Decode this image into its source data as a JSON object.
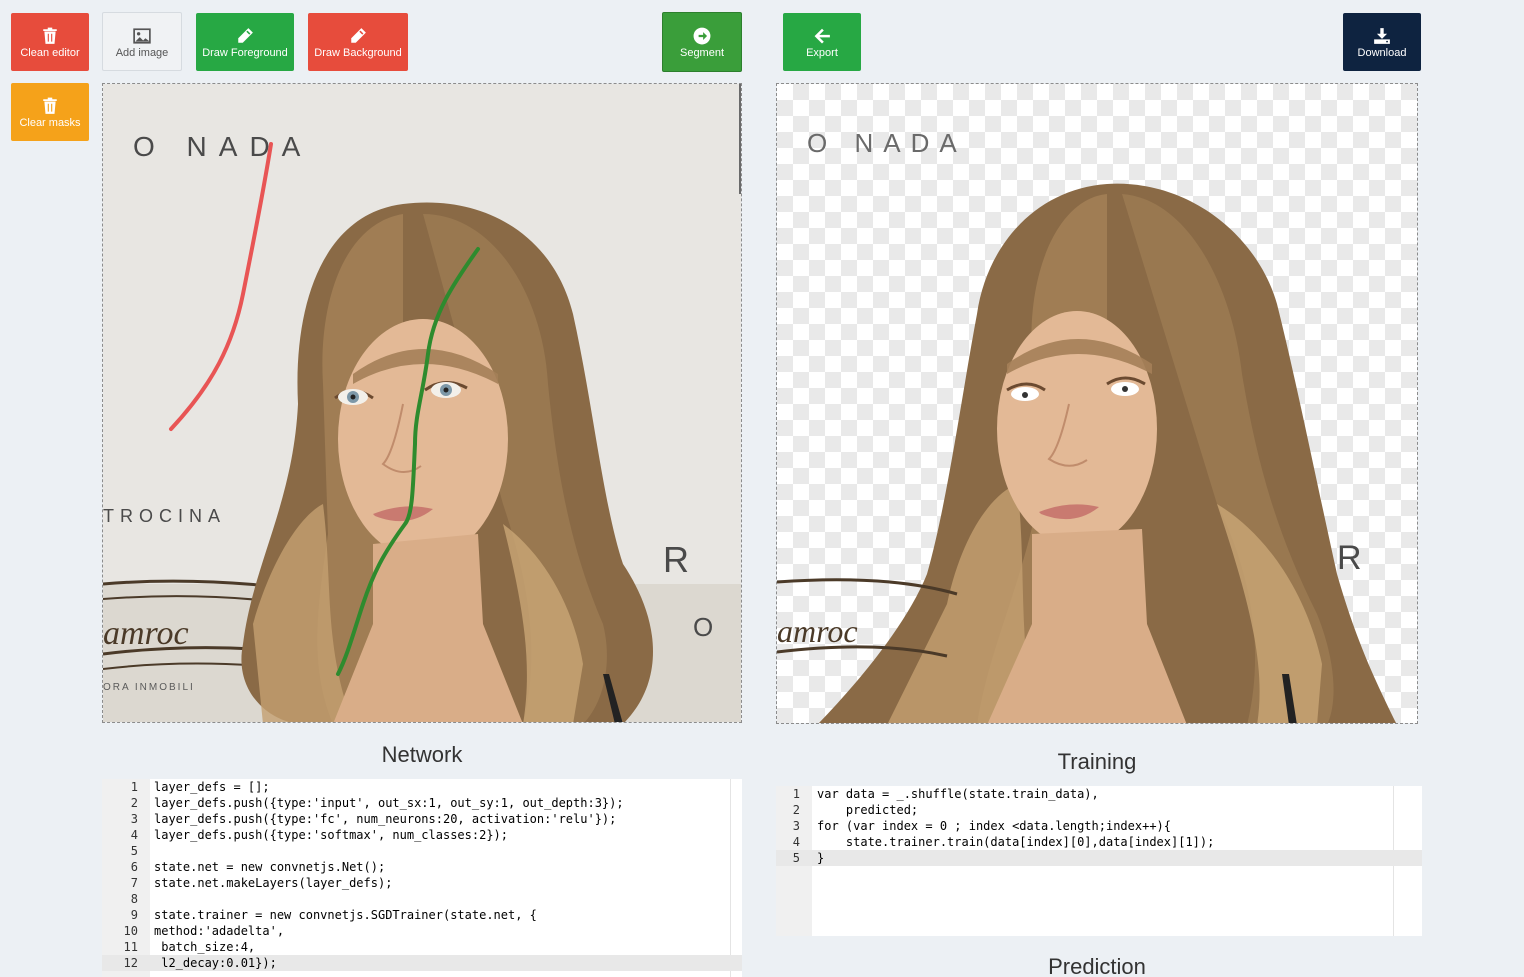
{
  "toolbar": {
    "clean_editor": "Clean editor",
    "add_image": "Add image",
    "draw_foreground": "Draw Foreground",
    "draw_background": "Draw Background",
    "segment": "Segment",
    "clear_masks": "Clear masks",
    "export": "Export",
    "download": "Download"
  },
  "colors": {
    "danger": "#e74c3c",
    "success": "#27a844",
    "warning": "#f5a21a",
    "dark": "#0e2340",
    "background_stroke": "#e85555",
    "foreground_stroke": "#2e8b2e"
  },
  "icons": {
    "clean_editor": "trash-icon",
    "add_image": "image-icon",
    "draw_foreground": "pencil-icon",
    "draw_background": "pencil-icon",
    "segment": "arrow-circle-right-icon",
    "clear_masks": "trash-icon",
    "export": "arrow-left-icon",
    "download": "download-icon"
  },
  "photo_text": {
    "top": "O NADA",
    "left": "TROCINA",
    "brand": "amroc",
    "bottom": "ORA INMOBILI",
    "right1": "R",
    "right2": "O"
  },
  "result_text": {
    "top": "O  NADA",
    "brand": "amroc",
    "right": "R"
  },
  "network": {
    "title": "Network",
    "lines": [
      {
        "n": "1",
        "code": "layer_defs = [];"
      },
      {
        "n": "2",
        "code": "layer_defs.push({type:'input', out_sx:1, out_sy:1, out_depth:3});"
      },
      {
        "n": "3",
        "code": "layer_defs.push({type:'fc', num_neurons:20, activation:'relu'});"
      },
      {
        "n": "4",
        "code": "layer_defs.push({type:'softmax', num_classes:2});"
      },
      {
        "n": "5",
        "code": ""
      },
      {
        "n": "6",
        "code": "state.net = new convnetjs.Net();"
      },
      {
        "n": "7",
        "code": "state.net.makeLayers(layer_defs);"
      },
      {
        "n": "8",
        "code": ""
      },
      {
        "n": "9",
        "code": "state.trainer = new convnetjs.SGDTrainer(state.net, {"
      },
      {
        "n": "10",
        "code": "method:'adadelta',"
      },
      {
        "n": "11",
        "code": " batch_size:4,"
      },
      {
        "n": "12",
        "code": " l2_decay:0.01});"
      }
    ]
  },
  "training": {
    "title": "Training",
    "lines": [
      {
        "n": "1",
        "code": "var data = _.shuffle(state.train_data),"
      },
      {
        "n": "2",
        "code": "    predicted;"
      },
      {
        "n": "3",
        "code": "for (var index = 0 ; index <data.length;index++){"
      },
      {
        "n": "4",
        "code": "    state.trainer.train(data[index][0],data[index][1]);"
      },
      {
        "n": "5",
        "code": "}"
      }
    ]
  },
  "prediction": {
    "title": "Prediction"
  }
}
